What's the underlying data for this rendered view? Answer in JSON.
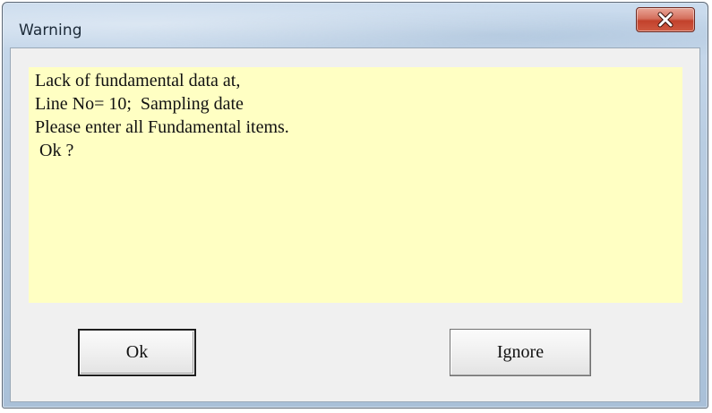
{
  "window": {
    "title": "Warning",
    "close_icon": "close-icon",
    "close_color": "#c94a34"
  },
  "message": {
    "background": "#ffffc3",
    "lines": [
      "Lack of fundamental data at,",
      "Line No= 10;  Sampling date",
      "Please enter all Fundamental items.",
      " Ok ?"
    ]
  },
  "buttons": {
    "ok_label": "Ok",
    "ignore_label": "Ignore"
  }
}
